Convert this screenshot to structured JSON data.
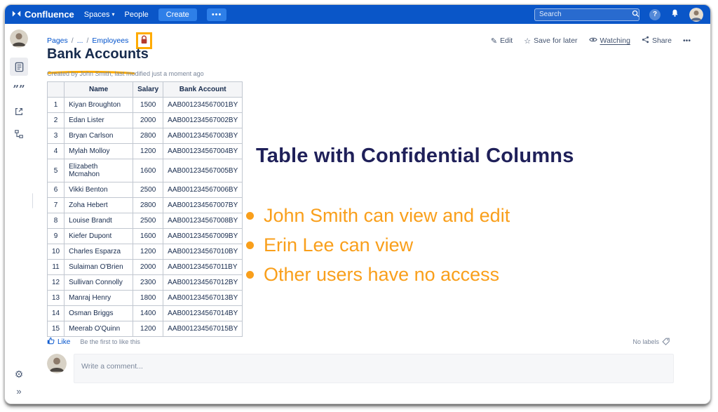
{
  "colors": {
    "navbar": "#0a56c8",
    "create_button": "#2e7fe8",
    "link_blue": "#0052CC",
    "annotation_navy": "#1f2059",
    "annotation_orange": "#f99f1b",
    "highlight_orange": "#ffab00",
    "lock_red": "#b3392e"
  },
  "navbar": {
    "brand": "Confluence",
    "menu": [
      {
        "label": "Spaces"
      },
      {
        "label": "People"
      }
    ],
    "create_label": "Create",
    "more_label": "•••",
    "search_placeholder": "Search"
  },
  "breadcrumb": {
    "items": [
      "Pages",
      "...",
      "Employees"
    ]
  },
  "page": {
    "title": "Bank Accounts",
    "byline": "Created by John Smith, last modified just a moment ago"
  },
  "actions": {
    "edit": "Edit",
    "save_for_later": "Save for later",
    "watching": "Watching",
    "share": "Share",
    "more": "•••"
  },
  "table": {
    "headers": [
      "",
      "Name",
      "Salary",
      "Bank Account"
    ],
    "rows": [
      [
        "1",
        "Kiyan Broughton",
        "1500",
        "AAB001234567001BY"
      ],
      [
        "2",
        "Edan Lister",
        "2000",
        "AAB001234567002BY"
      ],
      [
        "3",
        "Bryan Carlson",
        "2800",
        "AAB001234567003BY"
      ],
      [
        "4",
        "Mylah Molloy",
        "1200",
        "AAB001234567004BY"
      ],
      [
        "5",
        "Elizabeth Mcmahon",
        "1600",
        "AAB001234567005BY"
      ],
      [
        "6",
        "Vikki Benton",
        "2500",
        "AAB001234567006BY"
      ],
      [
        "7",
        "Zoha Hebert",
        "2800",
        "AAB001234567007BY"
      ],
      [
        "8",
        "Louise Brandt",
        "2500",
        "AAB001234567008BY"
      ],
      [
        "9",
        "Kiefer Dupont",
        "1600",
        "AAB001234567009BY"
      ],
      [
        "10",
        "Charles Esparza",
        "1200",
        "AAB001234567010BY"
      ],
      [
        "11",
        "Sulaiman O'Brien",
        "2000",
        "AAB001234567011BY"
      ],
      [
        "12",
        "Sullivan Connolly",
        "2300",
        "AAB001234567012BY"
      ],
      [
        "13",
        "Manraj Henry",
        "1800",
        "AAB001234567013BY"
      ],
      [
        "14",
        "Osman Briggs",
        "1400",
        "AAB001234567014BY"
      ],
      [
        "15",
        "Meerab O'Quinn",
        "1200",
        "AAB001234567015BY"
      ]
    ]
  },
  "annotation": {
    "title": "Table with Confidential Columns",
    "bullets": [
      "John Smith can view and edit",
      "Erin Lee can view",
      "Other users have no access"
    ]
  },
  "footer": {
    "like_label": "Like",
    "like_hint": "Be the first to like this",
    "labels_text": "No labels"
  },
  "comment": {
    "placeholder": "Write a comment..."
  }
}
